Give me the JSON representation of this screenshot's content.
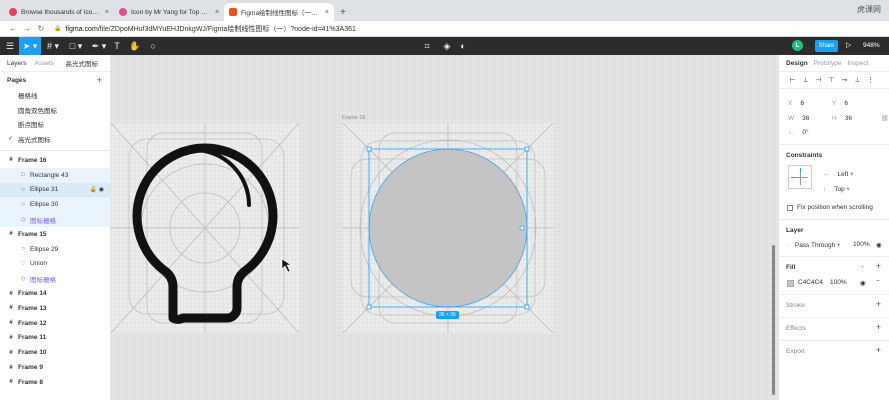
{
  "browser": {
    "tabs": [
      {
        "title": "Browse thousands of Icon ima",
        "color": "#e4405f",
        "active": false
      },
      {
        "title": "Icon by Mr Yang for Top Pick S",
        "color": "#ea4c89",
        "active": false
      },
      {
        "title": "Figma绘制线性图标（一）– Fig",
        "color": "#f24e1e",
        "active": true
      }
    ],
    "new_tab": "+",
    "url_host": "figma.com",
    "url_path": "/file/ZDpoMHuf3dMYuEHJDnkgWJ/Figma绘制线性图标（一）?node-id=41%3A361",
    "watermark": "虎课网"
  },
  "toolbar": {
    "avatar_letter": "L",
    "share_label": "Share",
    "zoom": "948%",
    "accent": "#18a0fb"
  },
  "layers_panel": {
    "tab_layers": "Layers",
    "tab_assets": "Assets",
    "current_page": "高光式图标",
    "pages_title": "Pages",
    "pages": [
      "栅格线",
      "圆角双色图标",
      "断点图标",
      "高光式图标"
    ],
    "layers": [
      {
        "name": "Frame 16",
        "kind": "frame",
        "glyph": "#"
      },
      {
        "name": "Rectangle 43",
        "kind": "child",
        "glyph": "□"
      },
      {
        "name": "Ellipse 31",
        "kind": "child",
        "glyph": "○",
        "state": "selected"
      },
      {
        "name": "Ellipse 30",
        "kind": "child",
        "glyph": "○"
      },
      {
        "name": "图标栅格",
        "kind": "comp",
        "glyph": "◇"
      },
      {
        "name": "Frame 15",
        "kind": "frame",
        "glyph": "#"
      },
      {
        "name": "Ellipse 29",
        "kind": "child",
        "glyph": "○"
      },
      {
        "name": "Union",
        "kind": "child",
        "glyph": "♡"
      },
      {
        "name": "图标栅格",
        "kind": "comp",
        "glyph": "◇"
      },
      {
        "name": "Frame 14",
        "kind": "frame",
        "glyph": "#"
      },
      {
        "name": "Frame 13",
        "kind": "frame",
        "glyph": "#"
      },
      {
        "name": "Frame 12",
        "kind": "frame",
        "glyph": "#"
      },
      {
        "name": "Frame 11",
        "kind": "frame",
        "glyph": "#"
      },
      {
        "name": "Frame 10",
        "kind": "frame",
        "glyph": "#"
      },
      {
        "name": "Frame 9",
        "kind": "frame",
        "glyph": "#"
      },
      {
        "name": "Frame 8",
        "kind": "frame",
        "glyph": "#"
      }
    ]
  },
  "canvas": {
    "frame_label": "Frame 16",
    "size_badge": "36 × 36",
    "ellipse_fill": "#c4c4c4"
  },
  "design_panel": {
    "tabs": [
      "Design",
      "Prototype",
      "Inspect"
    ],
    "x": "6",
    "y": "6",
    "w": "36",
    "h": "36",
    "rotation": "0°",
    "constraints_title": "Constraints",
    "constraint_h": "Left",
    "constraint_v": "Top",
    "fix_position": "Fix position when scrolling",
    "layer_title": "Layer",
    "blend": "Pass Through",
    "layer_opacity": "100%",
    "fill_title": "Fill",
    "fill_hex": "C4C4C4",
    "fill_opacity": "100%",
    "stroke_title": "Stroke",
    "effects_title": "Effects",
    "export_title": "Export"
  }
}
